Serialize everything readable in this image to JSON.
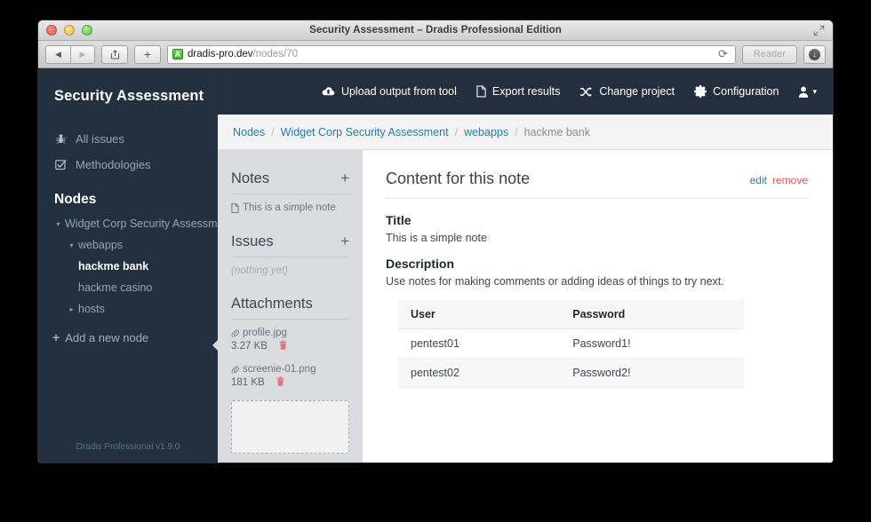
{
  "browser": {
    "window_title": "Security Assessment – Dradis Professional Edition",
    "back_icon": "◀",
    "forward_icon": "▶",
    "share_icon": "⇪",
    "new_tab_icon": "+",
    "favicon_letter": "A",
    "url_host": "dradis-pro.dev",
    "url_path": "/nodes/70",
    "reload_icon": "⟳",
    "reader_label": "Reader",
    "download_icon": "↓",
    "fullscreen_icon": "⤢"
  },
  "sidebar": {
    "brand": "Security Assessment",
    "nav": [
      {
        "label": "All issues",
        "icon": "bug-icon"
      },
      {
        "label": "Methodologies",
        "icon": "checkbox-check-icon"
      }
    ],
    "nodes_title": "Nodes",
    "tree": [
      {
        "label": "Widget Corp Security Assessment",
        "level": 1,
        "caret": "▾",
        "selected": false
      },
      {
        "label": "webapps",
        "level": 2,
        "caret": "▾",
        "selected": false
      },
      {
        "label": "hackme bank",
        "level": 3,
        "caret": "",
        "selected": true
      },
      {
        "label": "hackme casino",
        "level": 3,
        "caret": "",
        "selected": false
      },
      {
        "label": "hosts",
        "level": 2,
        "caret": "▸",
        "selected": false
      }
    ],
    "add_node_label": "Add a new node",
    "add_node_icon": "+",
    "footer": "Dradis Professional v1.9.0"
  },
  "header": {
    "items": [
      {
        "label": "Upload output from tool",
        "icon": "cloud-upload-icon"
      },
      {
        "label": "Export results",
        "icon": "file-icon"
      },
      {
        "label": "Change project",
        "icon": "shuffle-icon"
      },
      {
        "label": "Configuration",
        "icon": "gear-icon"
      }
    ],
    "user_menu_caret": "▾"
  },
  "breadcrumb": {
    "items": [
      "Nodes",
      "Widget Corp Security Assessment",
      "webapps"
    ],
    "current": "hackme bank",
    "separator": "/"
  },
  "mid_pane": {
    "notes": {
      "title": "Notes",
      "add_icon": "+",
      "entries": [
        {
          "label": "This is a simple note",
          "icon": "note-icon"
        }
      ]
    },
    "issues": {
      "title": "Issues",
      "add_icon": "+",
      "empty_text": "(nothing yet)"
    },
    "attachments": {
      "title": "Attachments",
      "files": [
        {
          "name": "profile.jpg",
          "size": "3.27 KB",
          "icon": "paperclip-icon",
          "delete_icon": "🗑"
        },
        {
          "name": "screenie-01.png",
          "size": "181 KB",
          "icon": "paperclip-icon",
          "delete_icon": "🗑"
        }
      ]
    }
  },
  "main": {
    "title": "Content for this note",
    "edit_label": "edit",
    "remove_label": "remove",
    "fields": [
      {
        "label": "Title",
        "value": "This is a simple note"
      },
      {
        "label": "Description",
        "value": "Use notes for making comments or adding ideas of things to try next."
      }
    ],
    "table": {
      "headers": [
        "User",
        "Password"
      ],
      "rows": [
        [
          "pentest01",
          "Password1!"
        ],
        [
          "pentest02",
          "Password2!"
        ]
      ]
    }
  },
  "colors": {
    "sidebar_bg": "#22303f",
    "header_bg": "#232f3d",
    "mid_pane_bg": "#dadcdf",
    "link": "#2a7ab0",
    "danger": "#d9534f"
  }
}
